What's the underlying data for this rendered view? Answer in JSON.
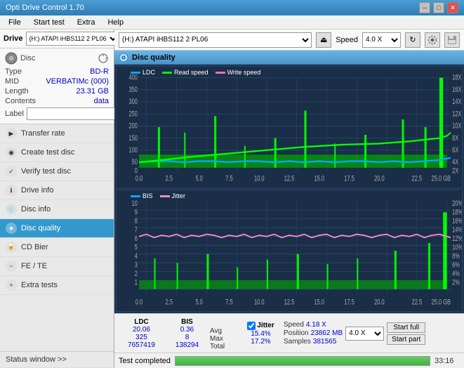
{
  "app": {
    "title": "Opti Drive Control 1.70",
    "minimize": "─",
    "maximize": "□",
    "close": "✕"
  },
  "menu": {
    "items": [
      "File",
      "Start test",
      "Extra",
      "Help"
    ]
  },
  "drive": {
    "label": "Drive",
    "selected": "(H:) ATAPI iHBS112  2 PL06",
    "speed_label": "Speed",
    "speed_selected": "4.0 X",
    "eject_icon": "⏏"
  },
  "disc": {
    "type_key": "Type",
    "type_val": "BD-R",
    "mid_key": "MID",
    "mid_val": "VERBATIMc (000)",
    "length_key": "Length",
    "length_val": "23.31 GB",
    "contents_key": "Contents",
    "contents_val": "data",
    "label_key": "Label",
    "label_val": ""
  },
  "nav": {
    "items": [
      {
        "id": "transfer-rate",
        "label": "Transfer rate",
        "icon": "▶"
      },
      {
        "id": "create-test-disc",
        "label": "Create test disc",
        "icon": "◉"
      },
      {
        "id": "verify-test-disc",
        "label": "Verify test disc",
        "icon": "✓"
      },
      {
        "id": "drive-info",
        "label": "Drive info",
        "icon": "ℹ"
      },
      {
        "id": "disc-info",
        "label": "Disc info",
        "icon": "📀"
      },
      {
        "id": "disc-quality",
        "label": "Disc quality",
        "icon": "★",
        "active": true
      },
      {
        "id": "cd-bier",
        "label": "CD Bier",
        "icon": "🍺"
      },
      {
        "id": "fe-te",
        "label": "FE / TE",
        "icon": "~"
      },
      {
        "id": "extra-tests",
        "label": "Extra tests",
        "icon": "+"
      }
    ]
  },
  "status_window": "Status window >>",
  "quality_panel": {
    "title": "Disc quality",
    "icon": "💿"
  },
  "chart1": {
    "legend": [
      {
        "color": "#00aaff",
        "label": "LDC"
      },
      {
        "color": "#00ff00",
        "label": "Read speed"
      },
      {
        "color": "#ff66cc",
        "label": "Write speed"
      }
    ],
    "y_left": [
      "400",
      "350",
      "300",
      "250",
      "200",
      "150",
      "100",
      "50",
      "0"
    ],
    "y_right": [
      "18X",
      "16X",
      "14X",
      "12X",
      "10X",
      "8X",
      "6X",
      "4X",
      "2X"
    ],
    "x_labels": [
      "0.0",
      "2.5",
      "5.0",
      "7.5",
      "10.0",
      "12.5",
      "15.0",
      "17.5",
      "20.0",
      "22.5",
      "25.0 GB"
    ]
  },
  "chart2": {
    "legend": [
      {
        "color": "#00aaff",
        "label": "BIS"
      },
      {
        "color": "#ff88cc",
        "label": "Jitter"
      }
    ],
    "y_left": [
      "10",
      "9",
      "8",
      "7",
      "6",
      "5",
      "4",
      "3",
      "2",
      "1"
    ],
    "y_right": [
      "20%",
      "18%",
      "16%",
      "14%",
      "12%",
      "10%",
      "8%",
      "6%",
      "4%",
      "2%"
    ],
    "x_labels": [
      "0.0",
      "2.5",
      "5.0",
      "7.5",
      "10.0",
      "12.5",
      "15.0",
      "17.5",
      "20.0",
      "22.5",
      "25.0 GB"
    ]
  },
  "stats": {
    "ldc_label": "LDC",
    "bis_label": "BIS",
    "jitter_label": "Jitter",
    "speed_label": "Speed",
    "jitter_checked": true,
    "rows": [
      {
        "name": "Avg",
        "ldc": "20.06",
        "bis": "0.36",
        "jitter": "15.4%"
      },
      {
        "name": "Max",
        "ldc": "325",
        "bis": "8",
        "jitter": "17.2%"
      },
      {
        "name": "Total",
        "ldc": "7657419",
        "bis": "138294",
        "jitter": ""
      }
    ],
    "speed_val": "4.18 X",
    "position_label": "Position",
    "position_val": "23862 MB",
    "samples_label": "Samples",
    "samples_val": "381565",
    "speed_select": "4.0 X",
    "start_full": "Start full",
    "start_part": "Start part"
  },
  "progress": {
    "text": "Test completed",
    "percent": 100,
    "time": "33:16"
  }
}
